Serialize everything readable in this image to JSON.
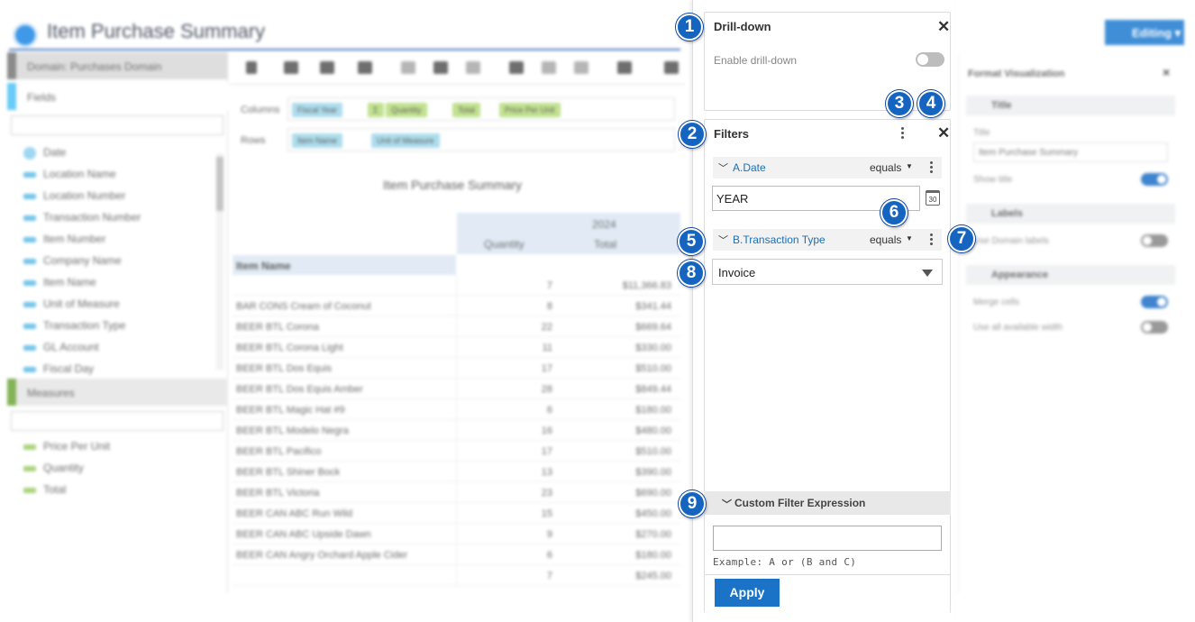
{
  "app": {
    "title": "Item Purchase Summary",
    "editing_label": "Editing"
  },
  "left_pane": {
    "domain": "Domain: Purchases Domain",
    "fields_label": "Fields",
    "fields": [
      "Date",
      "Location Name",
      "Location Number",
      "Transaction Number",
      "Item Number",
      "Company Name",
      "Item Name",
      "Unit of Measure",
      "Transaction Type",
      "GL Account",
      "Fiscal Day"
    ],
    "measures_label": "Measures",
    "measures": [
      "Price Per Unit",
      "Quantity",
      "Total"
    ]
  },
  "shelves": {
    "columns_label": "Columns",
    "rows_label": "Rows",
    "columns": [
      "Fiscal Year",
      "Σ",
      "Quantity",
      "Total",
      "Price Per Unit"
    ],
    "rows": [
      "Item Name",
      "Unit of Measure"
    ]
  },
  "grid": {
    "title": "Item Purchase Summary",
    "year": "2024",
    "col_quantity": "Quantity",
    "col_total": "Total",
    "row_header": "Item Name",
    "rows": [
      {
        "name": "",
        "qty": "7",
        "total": "$11,366.83"
      },
      {
        "name": "BAR CONS Cream of Coconut",
        "qty": "8",
        "total": "$341.44"
      },
      {
        "name": "BEER BTL Corona",
        "qty": "22",
        "total": "$669.64"
      },
      {
        "name": "BEER BTL Corona Light",
        "qty": "11",
        "total": "$330.00"
      },
      {
        "name": "BEER BTL Dos Equis",
        "qty": "17",
        "total": "$510.00"
      },
      {
        "name": "BEER BTL Dos Equis Amber",
        "qty": "28",
        "total": "$849.44"
      },
      {
        "name": "BEER BTL Magic Hat #9",
        "qty": "6",
        "total": "$180.00"
      },
      {
        "name": "BEER BTL Modelo Negra",
        "qty": "16",
        "total": "$480.00"
      },
      {
        "name": "BEER BTL Pacifico",
        "qty": "17",
        "total": "$510.00"
      },
      {
        "name": "BEER BTL Shiner Bock",
        "qty": "13",
        "total": "$390.00"
      },
      {
        "name": "BEER BTL Victoria",
        "qty": "23",
        "total": "$690.00"
      },
      {
        "name": "BEER CAN ABC Run Wild",
        "qty": "15",
        "total": "$450.00"
      },
      {
        "name": "BEER CAN ABC Upside Dawn",
        "qty": "9",
        "total": "$270.00"
      },
      {
        "name": "BEER CAN Angry Orchard Apple Cider",
        "qty": "6",
        "total": "$180.00"
      },
      {
        "name": "",
        "qty": "7",
        "total": "$245.00"
      }
    ]
  },
  "format_pane": {
    "title": "Format Visualization",
    "title_section": "Title",
    "title_label": "Title",
    "title_value": "Item Purchase Summary",
    "show_title": "Show title",
    "labels_section": "Labels",
    "domain_labels": "Use Domain labels",
    "appearance_section": "Appearance",
    "merge_cells": "Merge cells",
    "use_width": "Use all available width"
  },
  "drilldown": {
    "title": "Drill-down",
    "enable_label": "Enable drill-down",
    "enabled": false
  },
  "filters": {
    "title": "Filters",
    "items": [
      {
        "name": "A.Date",
        "operator": "equals",
        "value": "YEAR",
        "calendar_text": "30"
      },
      {
        "name": "B.Transaction Type",
        "operator": "equals",
        "value": "Invoice"
      }
    ],
    "custom_expression_label": "Custom Filter Expression",
    "custom_expression_value": "",
    "example": "Example: A or (B and C)",
    "apply_label": "Apply"
  },
  "callouts": [
    "1",
    "2",
    "3",
    "4",
    "5",
    "6",
    "7",
    "8",
    "9"
  ],
  "colors": {
    "accent": "#1a73c6",
    "callout": "#1565c0",
    "filter_name": "#1e6fb5"
  }
}
